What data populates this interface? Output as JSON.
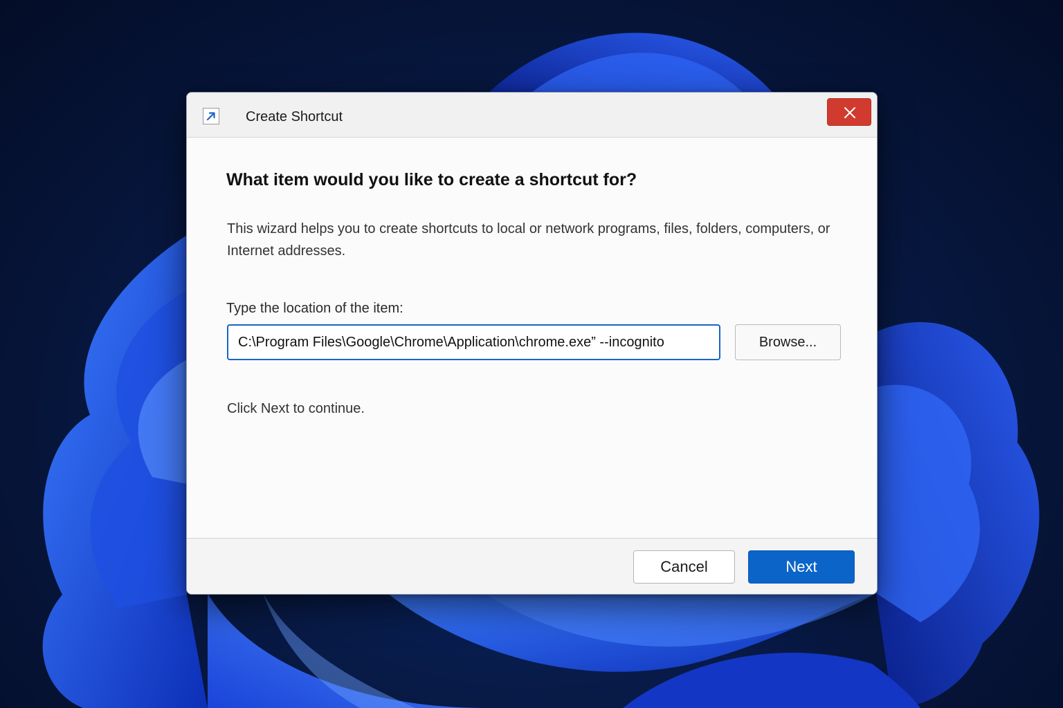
{
  "dialog": {
    "title": "Create Shortcut",
    "title_icon": "shortcut-arrow-icon",
    "close_icon": "close-icon"
  },
  "content": {
    "heading": "What item would you like to create a shortcut for?",
    "description": "This wizard helps you to create shortcuts to local or network programs, files, folders, computers, or Internet addresses.",
    "location_label": "Type the location of the item:",
    "location_value": "C:\\Program Files\\Google\\Chrome\\Application\\chrome.exe” --incognito",
    "browse_label": "Browse...",
    "continue_text": "Click Next to continue."
  },
  "footer": {
    "cancel_label": "Cancel",
    "next_label": "Next"
  },
  "colors": {
    "accent": "#0b64c8",
    "close": "#d13b2f",
    "input_border": "#1a63c7"
  }
}
